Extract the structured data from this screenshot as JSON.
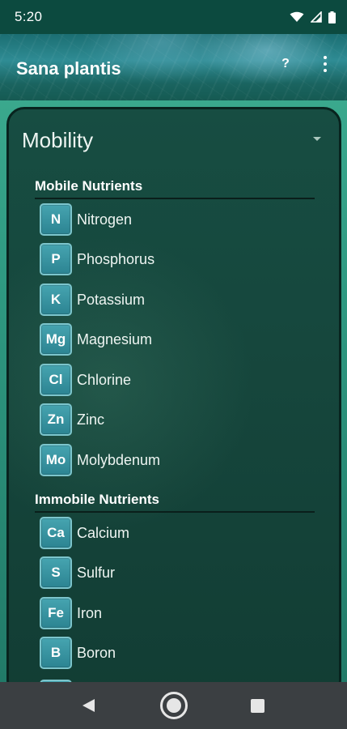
{
  "status_bar": {
    "time": "5:20",
    "icons": [
      "wifi-icon",
      "cellular-signal-icon",
      "battery-icon"
    ]
  },
  "app_bar": {
    "title": "Sana plantis",
    "help_label": "?",
    "more_icon": "more-vert-icon"
  },
  "filter": {
    "selected": "Mobility"
  },
  "sections": [
    {
      "title": "Mobile Nutrients",
      "items": [
        {
          "symbol": "N",
          "name": "Nitrogen"
        },
        {
          "symbol": "P",
          "name": "Phosphorus"
        },
        {
          "symbol": "K",
          "name": "Potassium"
        },
        {
          "symbol": "Mg",
          "name": "Magnesium"
        },
        {
          "symbol": "Cl",
          "name": "Chlorine"
        },
        {
          "symbol": "Zn",
          "name": "Zinc"
        },
        {
          "symbol": "Mo",
          "name": "Molybdenum"
        }
      ]
    },
    {
      "title": "Immobile Nutrients",
      "items": [
        {
          "symbol": "Ca",
          "name": "Calcium"
        },
        {
          "symbol": "S",
          "name": "Sulfur"
        },
        {
          "symbol": "Fe",
          "name": "Iron"
        },
        {
          "symbol": "B",
          "name": "Boron"
        }
      ]
    }
  ],
  "nav_bar": {
    "icons": [
      "back-icon",
      "home-icon",
      "recents-icon"
    ]
  },
  "colors": {
    "status_bar": "#0c4a3f",
    "card_bg": "#16473d",
    "badge": "#3695a2",
    "nav_bar": "#3b3f42"
  }
}
